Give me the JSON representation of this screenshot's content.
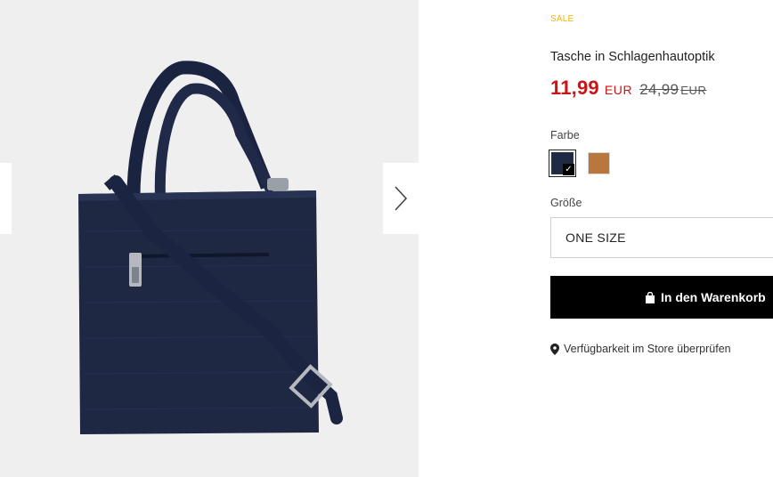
{
  "product": {
    "badge": "SALE",
    "title": "Tasche in Schlagenhautoptik",
    "price": "11,99",
    "currency": "EUR",
    "old_price": "24,99",
    "old_currency": "EUR"
  },
  "color": {
    "label": "Farbe",
    "options": [
      {
        "name": "navy",
        "hex": "#1f2a45",
        "selected": true
      },
      {
        "name": "cognac",
        "hex": "#b8773c",
        "selected": false
      }
    ]
  },
  "size": {
    "label": "Größe",
    "selected": "ONE SIZE"
  },
  "cart": {
    "label": "In den Warenkorb",
    "icon": "shopping-bag-icon"
  },
  "store": {
    "label": "Verfügbarkeit im Store überprüfen",
    "icon": "map-pin-icon"
  },
  "colors": {
    "sale": "#f2b300",
    "price": "#cc1417",
    "button": "#000000"
  }
}
